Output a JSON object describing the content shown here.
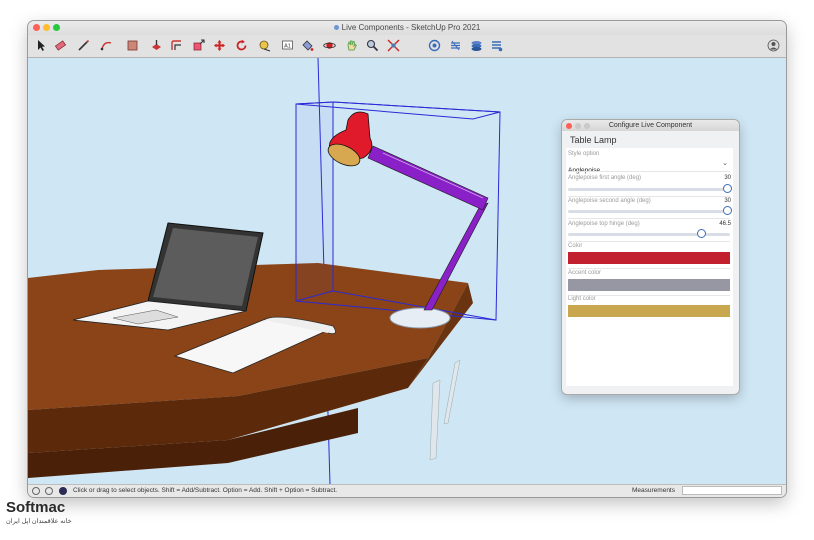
{
  "window": {
    "title": "Live Components - SketchUp Pro 2021"
  },
  "toolbar": {
    "tools": [
      "select-tool",
      "eraser-tool",
      "line-tool",
      "arc-tool",
      "shape-tool",
      "push-pull-tool",
      "offset-tool",
      "scale-tool",
      "move-tool",
      "rotate-tool",
      "tape-tool",
      "text-tool",
      "paint-bucket-tool",
      "orbit-tool",
      "pan-tool",
      "zoom-tool",
      "zoom-extents-tool",
      "extension-warehouse",
      "3d-warehouse",
      "layers-tool",
      "components-tool"
    ]
  },
  "status": {
    "hint": "Click or drag to select objects. Shift = Add/Subtract. Option = Add. Shift + Option = Subtract.",
    "measurements_label": "Measurements"
  },
  "panel": {
    "title": "Configure Live Component",
    "heading": "Table Lamp",
    "style_label": "Style option",
    "style_value": "Anglepoise",
    "slider1_label": "Anglepoise first angle (deg)",
    "slider1_value": "30",
    "slider1_fraction": 0.98,
    "slider2_label": "Anglepoise second angle (deg)",
    "slider2_value": "30",
    "slider2_fraction": 0.98,
    "slider3_label": "Anglepoise top hinge (deg)",
    "slider3_value": "46.5",
    "slider3_fraction": 0.82,
    "color_label": "Color",
    "color_value": "#c2202e",
    "accent_label": "Accent color",
    "accent_value": "#9697a2",
    "light_label": "Light color",
    "light_value": "#c9a74f"
  },
  "watermark": {
    "brand": "Softmac",
    "tagline": "خانه علاقمندان اپل ایران"
  }
}
